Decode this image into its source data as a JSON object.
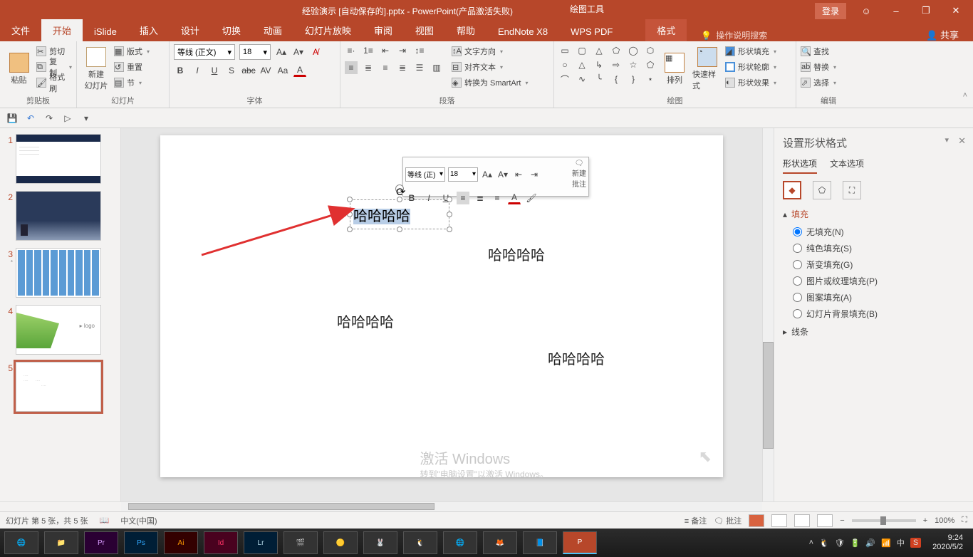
{
  "titlebar": {
    "doc_title": "经验演示 [自动保存的].pptx  -  PowerPoint(产品激活失败)",
    "drawtool": "绘图工具",
    "login": "登录",
    "minimize": "–",
    "restore": "❐",
    "close": "✕",
    "faceframe": "☺"
  },
  "menutabs": {
    "file": "文件",
    "home": "开始",
    "islide": "iSlide",
    "insert": "插入",
    "design": "设计",
    "transitions": "切换",
    "animations": "动画",
    "slideshow": "幻灯片放映",
    "review": "审阅",
    "view": "视图",
    "help": "帮助",
    "endnote": "EndNote X8",
    "wpspdf": "WPS PDF",
    "format": "格式",
    "tellme": "操作说明搜索",
    "share": "共享"
  },
  "ribbon": {
    "clipboard": {
      "label": "剪贴板",
      "paste": "粘贴",
      "cut": "剪切",
      "copy": "复制",
      "painter": "格式刷"
    },
    "slides": {
      "label": "幻灯片",
      "new": "新建\n幻灯片",
      "layout": "版式",
      "reset": "重置",
      "section": "节"
    },
    "font": {
      "label": "字体",
      "name": "等线 (正文)",
      "size": "18"
    },
    "paragraph": {
      "label": "段落",
      "textdir": "文字方向",
      "align": "对齐文本",
      "smartart": "转换为 SmartArt"
    },
    "drawing": {
      "label": "绘图",
      "arrange": "排列",
      "quick": "快速样式",
      "fill": "形状填充",
      "outline": "形状轮廓",
      "effects": "形状效果"
    },
    "editing": {
      "label": "编辑",
      "find": "查找",
      "replace": "替换",
      "select": "选择"
    }
  },
  "qat": {
    "save": "💾",
    "undo": "↶",
    "redo": "↷",
    "start": "▷",
    "more": "▾"
  },
  "minitool": {
    "font": "等线 (正)",
    "size": "18",
    "newnote": "新建\n批注"
  },
  "slide": {
    "text1": "哈哈哈哈",
    "text2": "哈哈哈哈",
    "text3": "哈哈哈哈",
    "text4": "哈哈哈哈"
  },
  "rpane": {
    "title": "设置形状格式",
    "tab_shape": "形状选项",
    "tab_text": "文本选项",
    "sect_fill": "填充",
    "sect_line": "线条",
    "opts": {
      "nofill": "无填充(N)",
      "solid": "纯色填充(S)",
      "gradient": "渐变填充(G)",
      "picture": "图片或纹理填充(P)",
      "pattern": "图案填充(A)",
      "slidebg": "幻灯片背景填充(B)"
    }
  },
  "watermark": {
    "line1": "激活 Windows",
    "line2": "转到\"电脑设置\"以激活 Windows。"
  },
  "statusbar": {
    "slideinfo": "幻灯片 第 5 张，共 5 张",
    "lang": "中文(中国)",
    "notes": "备注",
    "comments": "批注",
    "zoom": "100%"
  },
  "taskbar": {
    "items": [
      "🔵",
      "📁",
      "Pr",
      "Ps",
      "Ai",
      "Id",
      "Lr",
      "🎬",
      "🔴",
      "🐱",
      "🐧",
      "🌐",
      "🟠",
      "📘",
      "P"
    ],
    "time": "9:24",
    "date": "2020/5/2"
  }
}
